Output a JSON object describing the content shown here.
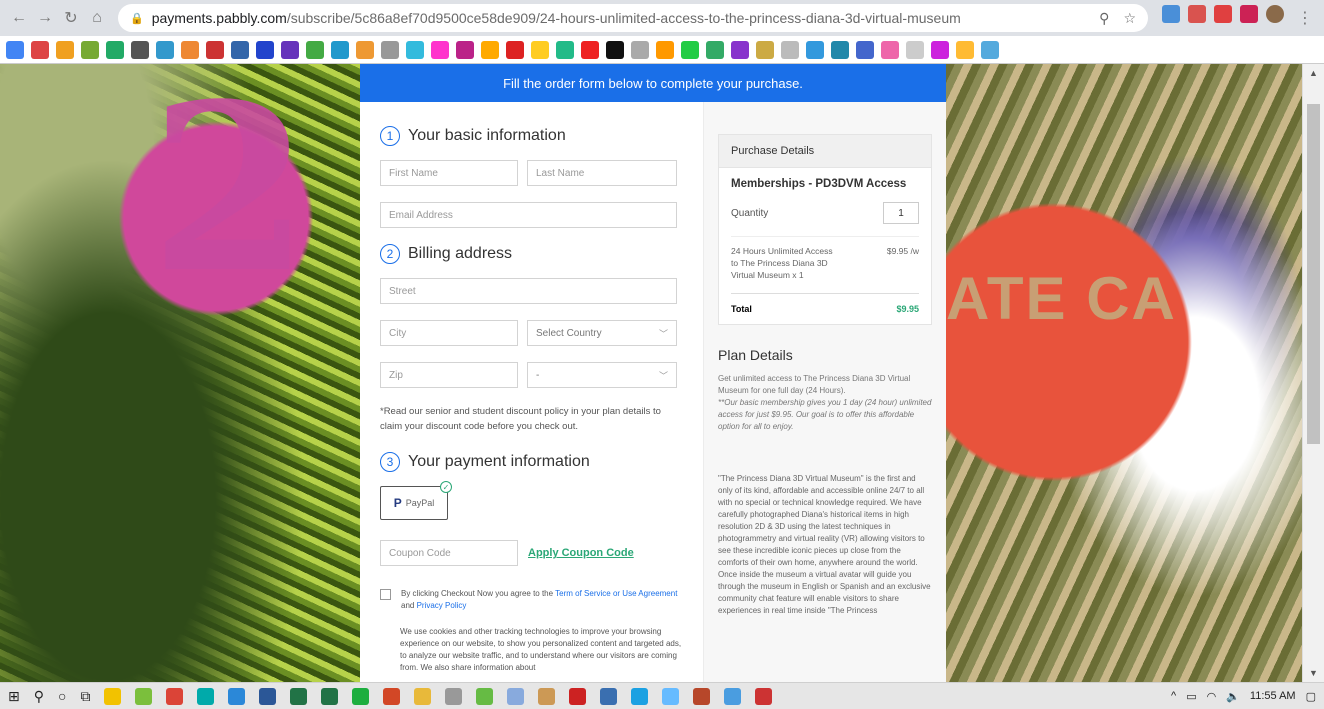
{
  "browser": {
    "url_domain": "payments.pabbly.com",
    "url_path": "/subscribe/5c86a8ef70d9500ce58de909/24-hours-unlimited-access-to-the-princess-diana-3d-virtual-museum"
  },
  "background": {
    "left_numeral": "2",
    "right_text": "ATE CA"
  },
  "banner": {
    "text": "Fill the order form below to complete your purchase."
  },
  "form": {
    "s1": {
      "num": "1",
      "title": "Your basic information",
      "first_placeholder": "First Name",
      "last_placeholder": "Last Name",
      "email_placeholder": "Email Address"
    },
    "s2": {
      "num": "2",
      "title": "Billing address",
      "street_placeholder": "Street",
      "city_placeholder": "City",
      "country_select": "Select Country",
      "zip_placeholder": "Zip",
      "state_select": "-"
    },
    "discount_note": "*Read our senior and student discount policy in your plan details to claim your discount code before you check out.",
    "s3": {
      "num": "3",
      "title": "Your payment information",
      "paypal_label": "PayPal",
      "paypal_mark": "P"
    },
    "coupon_placeholder": "Coupon Code",
    "apply_coupon": "Apply Coupon Code",
    "agree_text": "By clicking Checkout Now you agree to the ",
    "terms_link": "Term of Service or Use Agreement",
    "and_text": " and ",
    "privacy_link": "Privacy Policy",
    "cookie_text": "We use cookies and other tracking technologies to improve your browsing experience on our website, to show you personalized content and targeted ads, to analyze our website traffic, and to understand where our visitors are coming from. We also share information about"
  },
  "details": {
    "header": "Purchase Details",
    "membership": "Memberships - PD3DVM Access",
    "quantity_label": "Quantity",
    "quantity_value": "1",
    "item_desc": "24 Hours Unlimited Access to The Princess Diana 3D Virtual Museum x 1",
    "item_price": "$9.95 /w",
    "total_label": "Total",
    "total_value": "$9.95",
    "plan_title": "Plan Details",
    "plan_p1": "Get unlimited access to The Princess Diana 3D Virtual Museum for one full day (24 Hours).",
    "plan_p1_italic": "**Our basic membership gives you 1 day (24 hour) unlimited access for just $9.95. Our goal is to offer this affordable option for all to enjoy.",
    "plan_p2": "\"The Princess Diana 3D Virtual Museum\" is the first and only of its kind, affordable and accessible online 24/7 to all with no special or technical knowledge required. We have carefully photographed Diana's historical items in high resolution 2D & 3D using the latest techniques in photogrammetry and virtual reality (VR) allowing visitors to see these incredible iconic pieces up close from the comforts of their own home, anywhere around the world. Once inside the museum a virtual avatar will guide you through the museum in English or Spanish and an exclusive community chat feature will enable visitors to share experiences in real time inside \"The Princess"
  },
  "taskbar": {
    "time": "11:55 AM"
  },
  "colors": {
    "accent": "#1a6fe8",
    "green": "#2aa776"
  }
}
